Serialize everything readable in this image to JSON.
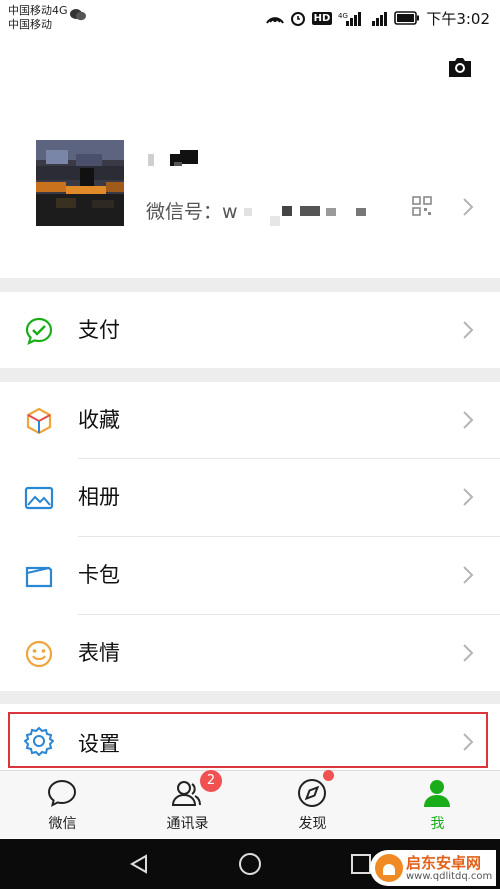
{
  "status": {
    "carrier_line1": "中国移动4G",
    "carrier_line2": "中国移动",
    "hd": "HD",
    "time": "下午3:02"
  },
  "profile": {
    "wxid_label": "微信号：",
    "wxid_prefix": "w"
  },
  "menu": [
    {
      "label": "支付",
      "icon": "wechat-pay-icon",
      "color": "#1aad19"
    },
    {
      "label": "收藏",
      "icon": "favorites-cube-icon",
      "color": "#f0a43c"
    },
    {
      "label": "相册",
      "icon": "album-picture-icon",
      "color": "#2b87d3"
    },
    {
      "label": "卡包",
      "icon": "card-wallet-icon",
      "color": "#2b87d3"
    },
    {
      "label": "表情",
      "icon": "emoji-smile-icon",
      "color": "#f0a43c"
    },
    {
      "label": "设置",
      "icon": "settings-gear-icon",
      "color": "#2b87d3"
    }
  ],
  "tabs": [
    {
      "label": "微信",
      "icon": "chat-bubble-icon"
    },
    {
      "label": "通讯录",
      "icon": "contacts-icon",
      "badge": "2"
    },
    {
      "label": "发现",
      "icon": "compass-icon"
    },
    {
      "label": "我",
      "icon": "me-person-icon",
      "active": true
    }
  ],
  "colors": {
    "accent": "#1aad19",
    "badge": "#f15151",
    "highlight": "#d9363e"
  },
  "watermark": {
    "title": "启东安卓网",
    "url": "www.qdlitdq.com"
  }
}
